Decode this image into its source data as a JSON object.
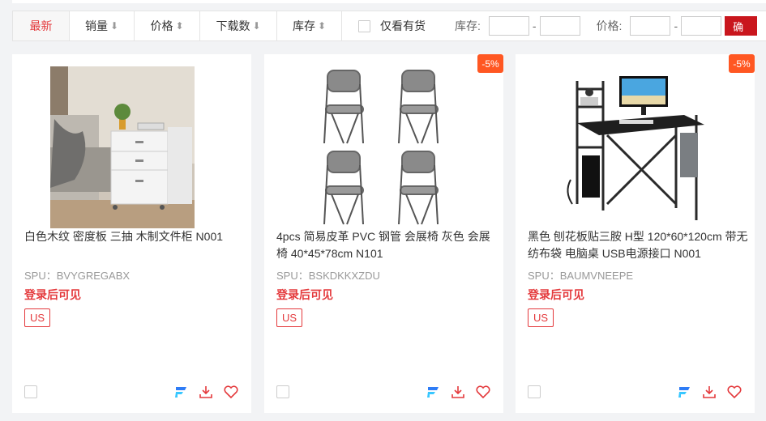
{
  "filter_bar": {
    "sorts": [
      {
        "label": "最新",
        "icon": ""
      },
      {
        "label": "销量",
        "icon": "⬇"
      },
      {
        "label": "价格",
        "icon": "⬍"
      },
      {
        "label": "下载数",
        "icon": "⬇"
      },
      {
        "label": "库存",
        "icon": "⬍"
      }
    ],
    "stock_only_label": "仅看有货",
    "stock_label": "库存:",
    "price_label": "价格:",
    "dash": "-",
    "confirm_label": "确"
  },
  "products": [
    {
      "title": "白色木纹 密度板 三抽 木制文件柜 N001",
      "spu": "SPU：BVYGREGABX",
      "login": "登录后可见",
      "tag": "US",
      "discount": ""
    },
    {
      "title": "4pcs 简易皮革 PVC 钢管 会展椅 灰色 会展椅 40*45*78cm N101",
      "spu": "SPU：BSKDKKXZDU",
      "login": "登录后可见",
      "tag": "US",
      "discount": "-5%"
    },
    {
      "title": "黑色 刨花板贴三胺 H型 120*60*120cm 带无纺布袋 电脑桌 USB电源接口 N001",
      "spu": "SPU：BAUMVNEEPE",
      "login": "登录后可见",
      "tag": "US",
      "discount": "-5%"
    }
  ]
}
